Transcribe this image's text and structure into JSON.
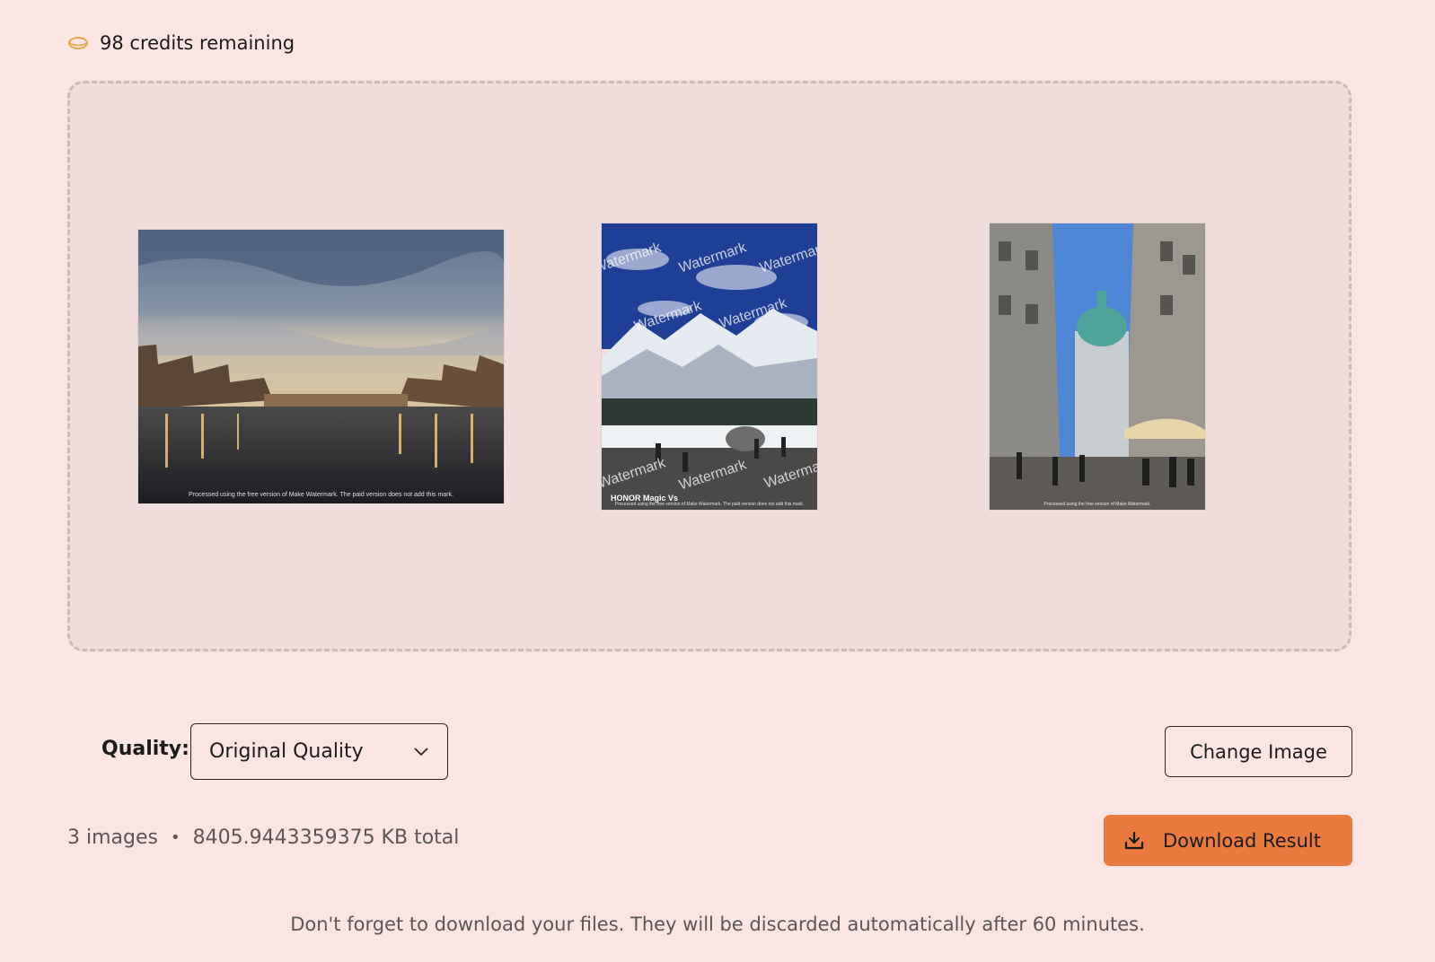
{
  "credits": {
    "text": "98 credits remaining",
    "icon": "coin-icon"
  },
  "images": [
    {
      "name": "florence-river",
      "footer": "Processed using the free version of Make Watermark. The paid version does not add this mark."
    },
    {
      "name": "snowy-mountains",
      "watermark": "Watermark",
      "brand": "HONOR Magic Vs",
      "footer": "Processed using the free version of Make Watermark. The paid version does not add this mark."
    },
    {
      "name": "city-street",
      "footer": "Processed using the free version of Make Watermark."
    }
  ],
  "quality": {
    "label": "Quality:",
    "selected": "Original Quality"
  },
  "buttons": {
    "change_image": "Change Image",
    "download": "Download Result"
  },
  "summary": {
    "count": "3 images",
    "separator": "•",
    "size": "8405.9443359375 KB total"
  },
  "notice": "Don't forget to download your files. They will be discarded automatically after 60 minutes.",
  "colors": {
    "background": "#fbe5e3",
    "dropzone": "#f0dcda",
    "accent": "#ea7a3d",
    "coin": "#e0a94a"
  }
}
